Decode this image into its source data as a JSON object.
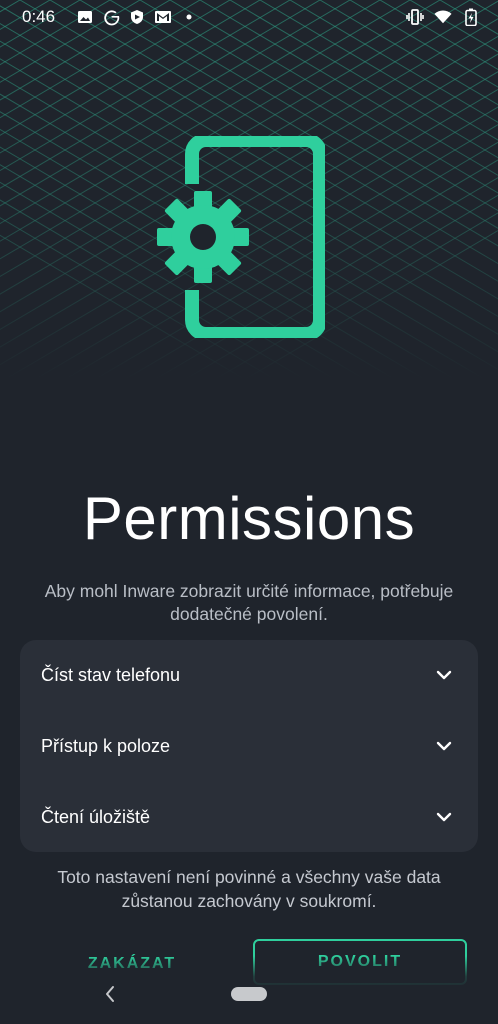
{
  "status_bar": {
    "time": "0:46",
    "left_icons": [
      "image-icon",
      "google-icon",
      "shield-icon",
      "mail-icon",
      "dot-icon"
    ],
    "right_icons": [
      "vibrate-icon",
      "wifi-icon",
      "battery-charging-icon"
    ]
  },
  "hero": {
    "icon": "phone-settings-icon",
    "accent_color": "#2fcf9d"
  },
  "page": {
    "title": "Permissions",
    "subtitle": "Aby mohl Inware zobrazit určité informace, potřebuje dodatečné povolení."
  },
  "permissions": [
    {
      "label": "Číst stav telefonu",
      "icon": "chevron-down-icon"
    },
    {
      "label": "Přístup k poloze",
      "icon": "chevron-down-icon"
    },
    {
      "label": "Čtení úložiště",
      "icon": "chevron-down-icon"
    }
  ],
  "note": "Toto nastavení není povinné a všechny vaše data zůstanou zachovány v soukromí.",
  "buttons": {
    "deny": "ZAKÁZAT",
    "allow": "POVOLIT"
  },
  "colors": {
    "background": "#1f242c",
    "card": "#2a2f38",
    "accent": "#2fcf9d",
    "grid": "#2fa88a"
  }
}
